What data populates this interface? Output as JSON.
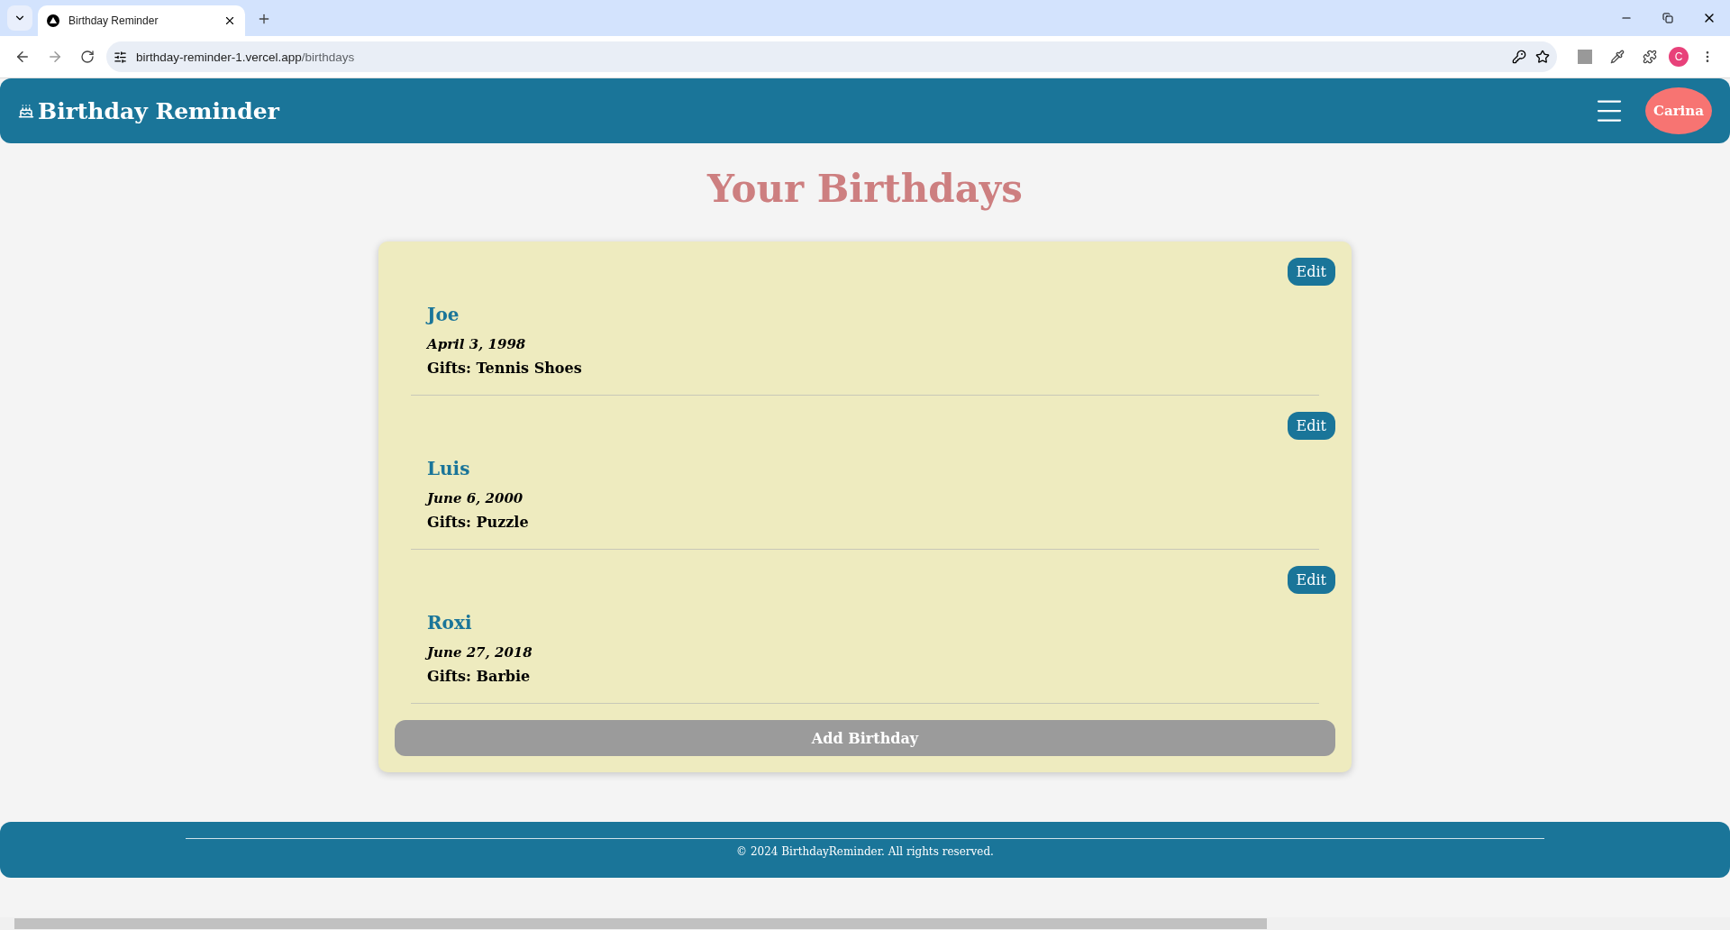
{
  "browser": {
    "tab_title": "Birthday Reminder",
    "url_host": "birthday-reminder-1.vercel.app",
    "url_path": "/birthdays",
    "profile_initial": "C"
  },
  "header": {
    "title": "Birthday Reminder",
    "user": "Carina"
  },
  "page_title": "Your Birthdays",
  "birthdays": [
    {
      "name": "Joe",
      "date": "April 3, 1998",
      "gifts": "Gifts: Tennis Shoes",
      "edit": "Edit"
    },
    {
      "name": "Luis",
      "date": "June 6, 2000",
      "gifts": "Gifts: Puzzle",
      "edit": "Edit"
    },
    {
      "name": "Roxi",
      "date": "June 27, 2018",
      "gifts": "Gifts: Barbie",
      "edit": "Edit"
    }
  ],
  "add_button": "Add Birthday",
  "footer": "© 2024 BirthdayReminder. All rights reserved."
}
